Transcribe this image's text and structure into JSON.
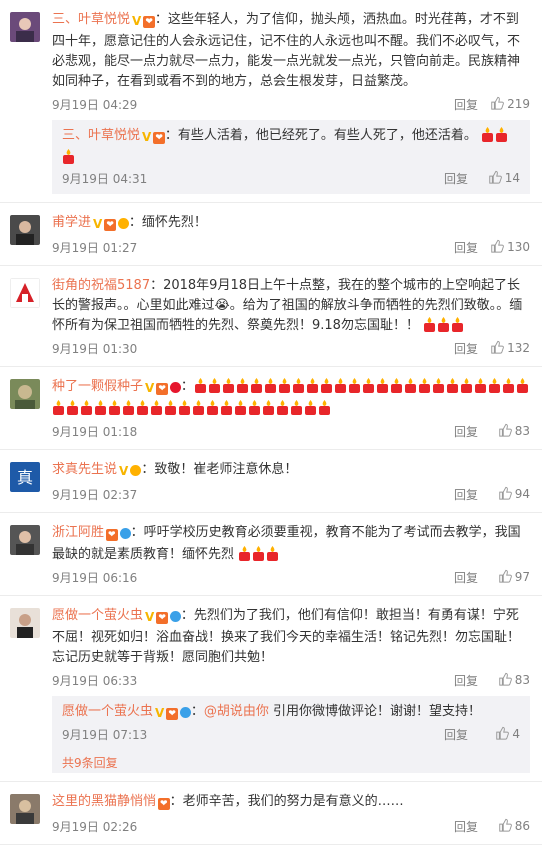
{
  "comments": [
    {
      "user": "三、叶草悦悦",
      "text": "：这些年轻人，为了信仰，抛头颅，洒热血。时光荏苒，才不到四十年，愿意记住的人会永远记住，记不住的人永远也叫不醒。我们不必叹气，不必悲观，能尽一点力就尽一点力，能发一点光就发一点光，只管向前走。民族精神如同种子，在看到或看不到的地方，总会生根发芽，日益繁茂。",
      "time": "9月19日 04:29",
      "reply": "回复",
      "likes": "219",
      "replies": [
        {
          "user": "三、叶草悦悦",
          "text": "：有些人活着，他已经死了。有些人死了，他还活着。",
          "time": "9月19日 04:31",
          "reply": "回复",
          "likes": "14"
        }
      ]
    },
    {
      "user": "甫学进",
      "text": "：缅怀先烈！",
      "time": "9月19日 01:27",
      "reply": "回复",
      "likes": "130"
    },
    {
      "user": "街角的祝福5187",
      "text": "：2018年9月18日上午十点整，我在的整个城市的上空响起了长长的警报声。。心里如此难过😭。给为了祖国的解放斗争而牺牲的先烈们致敬。。缅怀所有为保卫祖国而牺牲的先烈、祭奠先烈！9.18勿忘国耻！！",
      "time": "9月19日 01:30",
      "reply": "回复",
      "likes": "132"
    },
    {
      "user": "种了一颗假种子",
      "text": "：",
      "time": "9月19日 01:18",
      "reply": "回复",
      "likes": "83"
    },
    {
      "user": "求真先生说",
      "text": "：致敬！崔老师注意休息！",
      "time": "9月19日 02:37",
      "reply": "回复",
      "likes": "94"
    },
    {
      "user": "浙江阿胜",
      "text": "：呼吁学校历史教育必须要重视，教育不能为了考试而去教学，我国最缺的就是素质教育！缅怀先烈",
      "time": "9月19日 06:16",
      "reply": "回复",
      "likes": "97"
    },
    {
      "user": "愿做一个萤火虫",
      "text": "：先烈们为了我们，他们有信仰！敢担当！有勇有谋！宁死不屈！视死如归！浴血奋战！换来了我们今天的幸福生活！铭记先烈！勿忘国耻！忘记历史就等于背叛！愿同胞们共勉！",
      "time": "9月19日 06:33",
      "reply": "回复",
      "likes": "83",
      "replies": [
        {
          "user": "愿做一个萤火虫",
          "mention": "@胡说由你",
          "text": "引用你微博做评论！谢谢！望支持！",
          "time": "9月19日 07:13",
          "reply": "回复",
          "likes": "4"
        }
      ],
      "more": "共9条回复"
    },
    {
      "user": "这里的黑猫静悄悄",
      "text": "：老师辛苦，我们的努力是有意义的……",
      "time": "9月19日 02:26",
      "reply": "回复",
      "likes": "86"
    }
  ],
  "icons": {
    "candle": "candle-emoji-icon",
    "thumb": "thumbs-up-icon",
    "verified": "verified-v-icon"
  },
  "colors": {
    "username": "#eb7350",
    "meta": "#808080",
    "candle": "#e8262a",
    "flame": "#ffb100"
  }
}
